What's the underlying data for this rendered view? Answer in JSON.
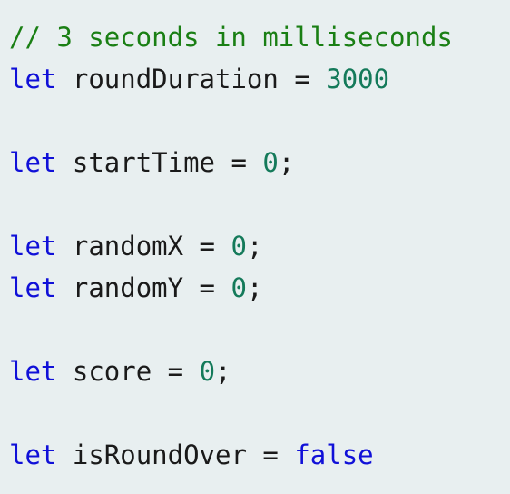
{
  "colors": {
    "background": "#e8eff0",
    "comment": "#1a7f14",
    "keyword": "#1010d8",
    "identifier": "#1a1a1a",
    "number": "#147a5a",
    "boolean": "#1010d8"
  },
  "code": {
    "line1": {
      "comment": "// 3 seconds in milliseconds"
    },
    "line2": {
      "keyword": "let",
      "ident": "roundDuration",
      "op": "=",
      "value": "3000"
    },
    "line4": {
      "keyword": "let",
      "ident": "startTime",
      "op": "=",
      "value": "0",
      "punct": ";"
    },
    "line6": {
      "keyword": "let",
      "ident": "randomX",
      "op": "=",
      "value": "0",
      "punct": ";"
    },
    "line7": {
      "keyword": "let",
      "ident": "randomY",
      "op": "=",
      "value": "0",
      "punct": ";"
    },
    "line9": {
      "keyword": "let",
      "ident": "score",
      "op": "=",
      "value": "0",
      "punct": ";"
    },
    "line11": {
      "keyword": "let",
      "ident": "isRoundOver",
      "op": "=",
      "value": "false"
    }
  }
}
